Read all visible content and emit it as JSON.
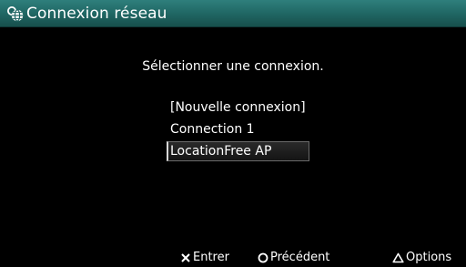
{
  "window": {
    "title": "Connexion réseau",
    "title_icon": "network-globe-icon"
  },
  "main": {
    "prompt": "Sélectionner une connexion.",
    "connections": [
      {
        "label": "[Nouvelle connexion]",
        "selected": false
      },
      {
        "label": "Connection 1",
        "selected": false
      },
      {
        "label": "LocationFree AP",
        "selected": true
      }
    ]
  },
  "footer": {
    "enter": {
      "icon": "cross-button-icon",
      "label": "Entrer"
    },
    "back": {
      "icon": "circle-button-icon",
      "label": "Précédent"
    },
    "options": {
      "icon": "triangle-button-icon",
      "label": "Options"
    }
  },
  "colors": {
    "title_bar": "#1f6562",
    "background": "#000000",
    "text": "#ffffff"
  }
}
